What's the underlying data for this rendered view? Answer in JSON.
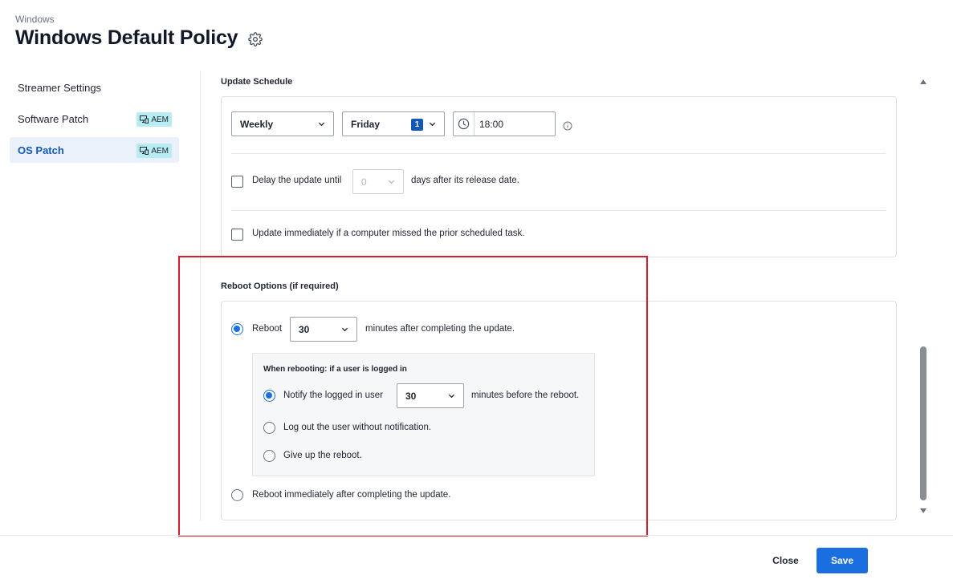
{
  "header": {
    "breadcrumb": "Windows",
    "title": "Windows Default Policy",
    "settings_icon": "gear-icon"
  },
  "sidebar": {
    "items": [
      {
        "label": "Streamer Settings",
        "badge": "",
        "active": false
      },
      {
        "label": "Software Patch",
        "badge": "AEM",
        "active": false
      },
      {
        "label": "OS Patch",
        "badge": "AEM",
        "active": true
      }
    ]
  },
  "update_schedule": {
    "title": "Update Schedule",
    "frequency": "Weekly",
    "day": "Friday",
    "day_count": "1",
    "time": "18:00",
    "delay_label_before": "Delay the update until",
    "delay_value": "0",
    "delay_label_after": "days after its release date.",
    "delay_checked": false,
    "missed_label": "Update immediately if a computer missed the prior scheduled task.",
    "missed_checked": false
  },
  "reboot_options": {
    "title": "Reboot Options (if required)",
    "reboot_label": "Reboot",
    "reboot_minutes": "30",
    "reboot_after_label": "minutes after completing the update.",
    "logged_in_title": "When rebooting: if a user is logged in",
    "notify_label": "Notify the logged in user",
    "notify_minutes": "30",
    "notify_after_label": "minutes before the reboot.",
    "logout_label": "Log out the user without notification.",
    "giveup_label": "Give up the reboot.",
    "immediate_label": "Reboot immediately after completing the update."
  },
  "footer": {
    "close_label": "Close",
    "save_label": "Save"
  },
  "colors": {
    "accent": "#1a6ee0",
    "highlight": "#d81e2b",
    "badge_bg": "#b7ecf2"
  }
}
